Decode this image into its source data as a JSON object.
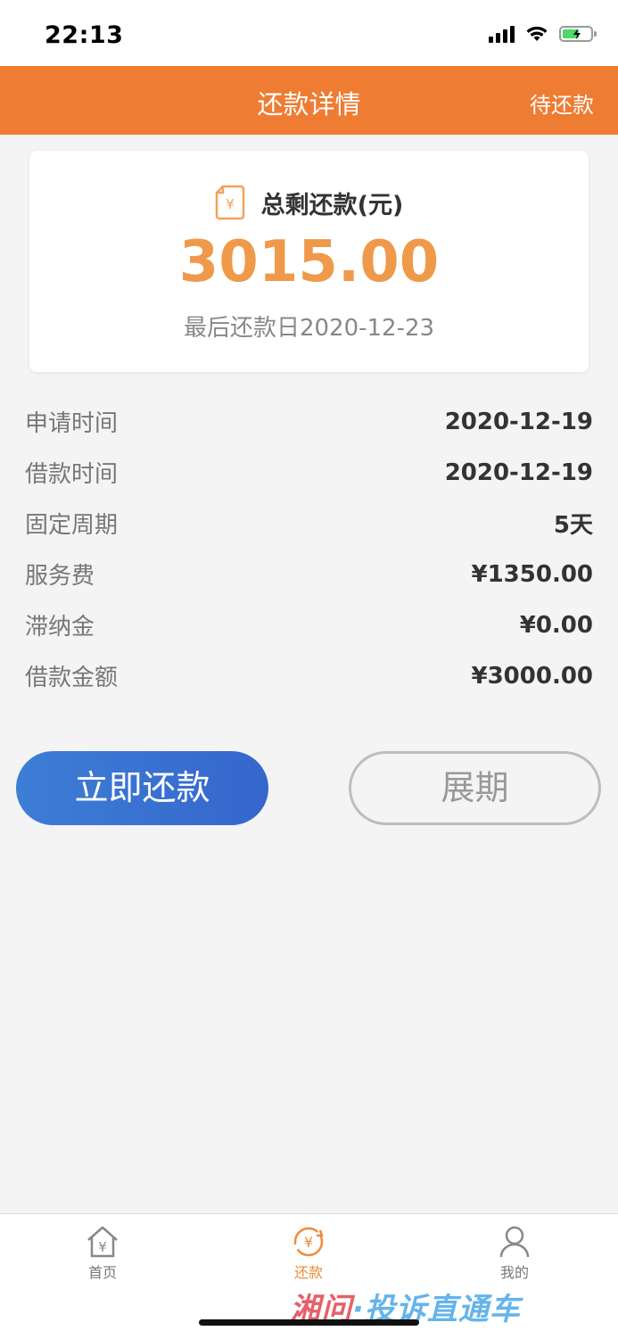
{
  "status_bar": {
    "time": "22:13"
  },
  "header": {
    "title": "还款详情",
    "status": "待还款"
  },
  "summary": {
    "label": "总剩还款(元)",
    "amount": "3015.00",
    "due_date": "最后还款日2020-12-23",
    "icon": "yen-document-icon"
  },
  "details": [
    {
      "label": "申请时间",
      "value": "2020-12-19"
    },
    {
      "label": "借款时间",
      "value": "2020-12-19"
    },
    {
      "label": "固定周期",
      "value": "5天"
    },
    {
      "label": "服务费",
      "value": "¥1350.00"
    },
    {
      "label": "滞纳金",
      "value": "¥0.00"
    },
    {
      "label": "借款金额",
      "value": "¥3000.00"
    }
  ],
  "actions": {
    "pay": "立即还款",
    "extend": "展期"
  },
  "tabs": [
    {
      "label": "首页",
      "icon": "home-yen-icon",
      "active": false
    },
    {
      "label": "还款",
      "icon": "yen-refresh-icon",
      "active": true
    },
    {
      "label": "我的",
      "icon": "user-icon",
      "active": false
    }
  ],
  "watermark": {
    "part1": "湘问",
    "part2": "·投诉直通车"
  },
  "colors": {
    "accent": "#ee7c33",
    "amount": "#ef9a4b",
    "primary_button": "#3a72d2"
  }
}
